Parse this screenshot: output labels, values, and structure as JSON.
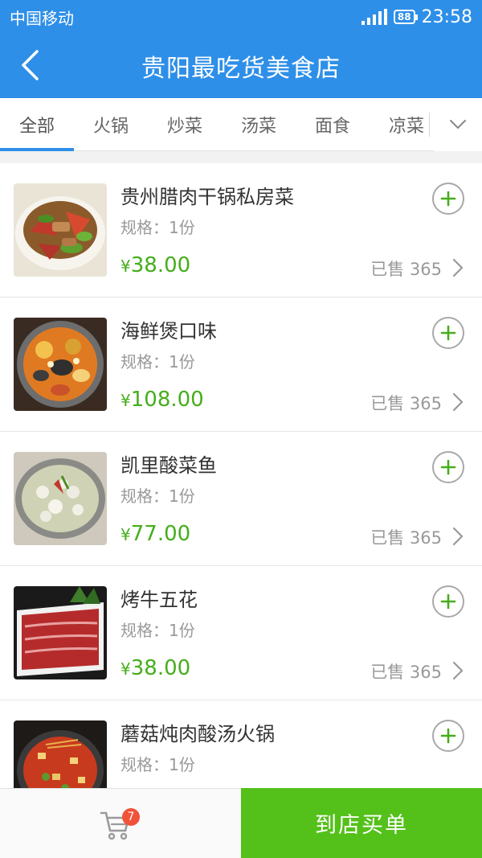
{
  "status_bar": {
    "carrier": "中国移动",
    "battery": "88",
    "time": "23:58"
  },
  "header": {
    "title": "贵阳最吃货美食店",
    "back_icon": "chevron-left-icon"
  },
  "tabs": [
    {
      "label": "全部",
      "active": true
    },
    {
      "label": "火锅",
      "active": false
    },
    {
      "label": "炒菜",
      "active": false
    },
    {
      "label": "汤菜",
      "active": false
    },
    {
      "label": "面食",
      "active": false
    },
    {
      "label": "凉菜",
      "active": false
    }
  ],
  "tabs_more_icon": "chevron-down-icon",
  "items": [
    {
      "name": "贵州腊肉干锅私房菜",
      "spec": "规格：1份",
      "currency": "¥",
      "price": "38.00",
      "sold": "已售 365",
      "image": "stir-fried-pork-image"
    },
    {
      "name": "海鲜煲口味",
      "spec": "规格：1份",
      "currency": "¥",
      "price": "108.00",
      "sold": "已售 365",
      "image": "seafood-pot-image"
    },
    {
      "name": "凯里酸菜鱼",
      "spec": "规格：1份",
      "currency": "¥",
      "price": "77.00",
      "sold": "已售 365",
      "image": "pickled-fish-image"
    },
    {
      "name": "烤牛五花",
      "spec": "规格：1份",
      "currency": "¥",
      "price": "38.00",
      "sold": "已售 365",
      "image": "beef-brisket-image"
    },
    {
      "name": "蘑菇炖肉酸汤火锅",
      "spec": "规格：1份",
      "currency": "¥",
      "price": "",
      "sold": "",
      "image": "sour-soup-hotpot-image"
    }
  ],
  "bottom_bar": {
    "cart_count": "7",
    "checkout_label": "到店买单"
  },
  "colors": {
    "primary_blue": "#2e8fe8",
    "price_green": "#45ae1b",
    "checkout_green": "#54c01a",
    "badge_red": "#f0523a"
  }
}
